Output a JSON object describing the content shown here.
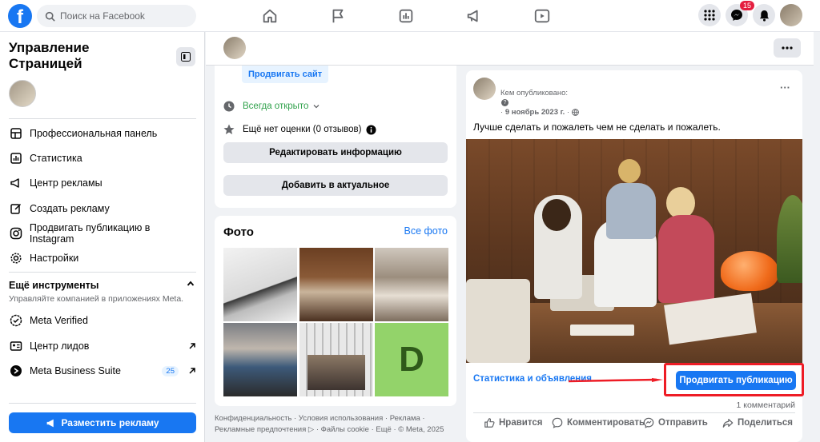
{
  "topbar": {
    "logo": "f",
    "search_placeholder": "Поиск на Facebook",
    "notification_count": "15",
    "nav_icons": [
      "home-icon",
      "flag-icon",
      "analytics-icon",
      "megaphone-icon",
      "video-icon"
    ]
  },
  "sidebar": {
    "title": "Управление Страницей",
    "items": [
      {
        "label": "Профессиональная панель",
        "icon": "dashboard-icon"
      },
      {
        "label": "Статистика",
        "icon": "insights-icon"
      },
      {
        "label": "Центр рекламы",
        "icon": "ads-center-icon"
      },
      {
        "label": "Создать рекламу",
        "icon": "create-ad-icon"
      },
      {
        "label": "Продвигать публикацию в Instagram",
        "icon": "instagram-icon"
      },
      {
        "label": "Настройки",
        "icon": "gear-icon"
      }
    ],
    "section_title": "Ещё инструменты",
    "section_subtitle": "Управляйте компанией в приложениях Meta.",
    "tools": [
      {
        "label": "Meta Verified",
        "icon": "verified-icon"
      },
      {
        "label": "Центр лидов",
        "icon": "leads-icon"
      },
      {
        "label": "Meta Business Suite",
        "icon": "business-suite-icon",
        "badge": "25"
      }
    ],
    "promote_label": "Разместить рекламу"
  },
  "info_card": {
    "site_button": "Продвигать сайт",
    "hours": "Всегда открыто",
    "rating": "Ещё нет оценки (0 отзывов)",
    "edit_button": "Редактировать информацию",
    "featured_button": "Добавить в актуальное"
  },
  "photos": {
    "title": "Фото",
    "all_link": "Все фото",
    "letter_tile": "D"
  },
  "footer": {
    "line1": "Конфиденциальность · Условия использования · Реклама ·",
    "line2": "Рекламные предпочтения ▷ · Файлы cookie · Ещё · © Meta, 2025"
  },
  "post": {
    "published_by": "Кем опубликовано:",
    "date": "9 ноябрь 2023 г.",
    "text": "Лучше сделать и пожалеть чем не сделать и пожалеть.",
    "stats_link": "Статистика и объявления",
    "boost_button": "Продвигать публикацию",
    "comments": "1 комментарий",
    "actions": {
      "like": "Нравится",
      "comment": "Комментировать",
      "send": "Отправить",
      "share": "Поделиться"
    }
  },
  "colors": {
    "brand": "#1877f2",
    "highlight": "#ee1c25",
    "open_status": "#31a24c"
  }
}
